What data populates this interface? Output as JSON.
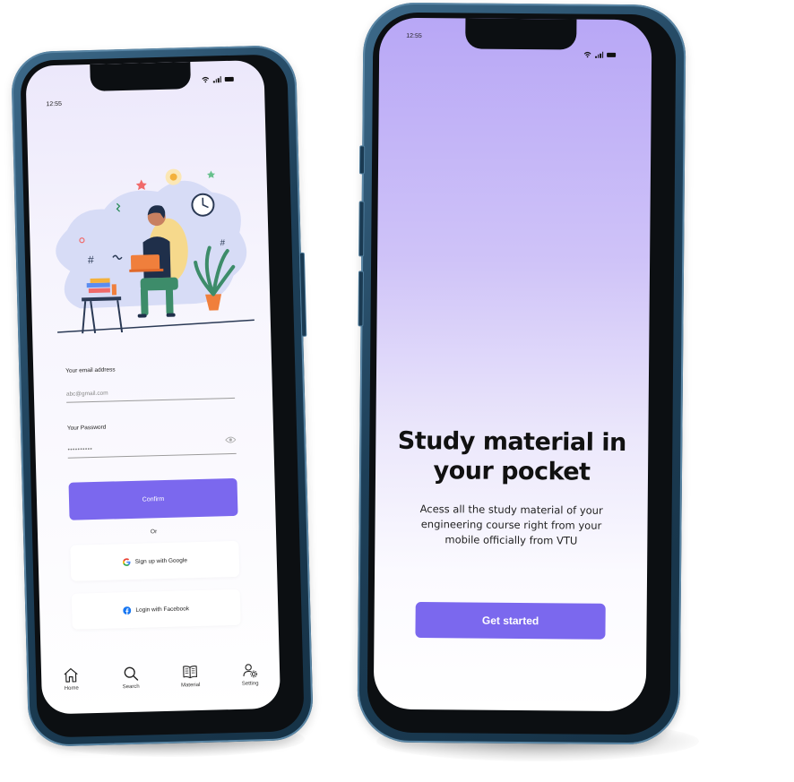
{
  "login_phone": {
    "status_time": "12:55",
    "email_label": "Your email address",
    "email_value": "abc@gmail.com",
    "password_label": "Your Password",
    "password_value": "••••••••••",
    "confirm_label": "Confirm",
    "or_text": "Or",
    "google_label": "Sign up with Google",
    "facebook_label": "Login with Facebook",
    "nav": [
      {
        "label": "Home",
        "icon": "home-icon"
      },
      {
        "label": "Search",
        "icon": "search-icon"
      },
      {
        "label": "Material",
        "icon": "book-icon"
      },
      {
        "label": "Setting",
        "icon": "settings-icon"
      }
    ]
  },
  "onboarding_phone": {
    "status_time": "12:55",
    "title": "Study material in your pocket",
    "subtitle": "Acess all the study material of your engineering course right from your mobile officially from VTU",
    "cta_label": "Get started"
  },
  "colors": {
    "accent": "#7b68ee",
    "frame": "#1d3f58",
    "gradient_top": "#b8a7f6"
  }
}
